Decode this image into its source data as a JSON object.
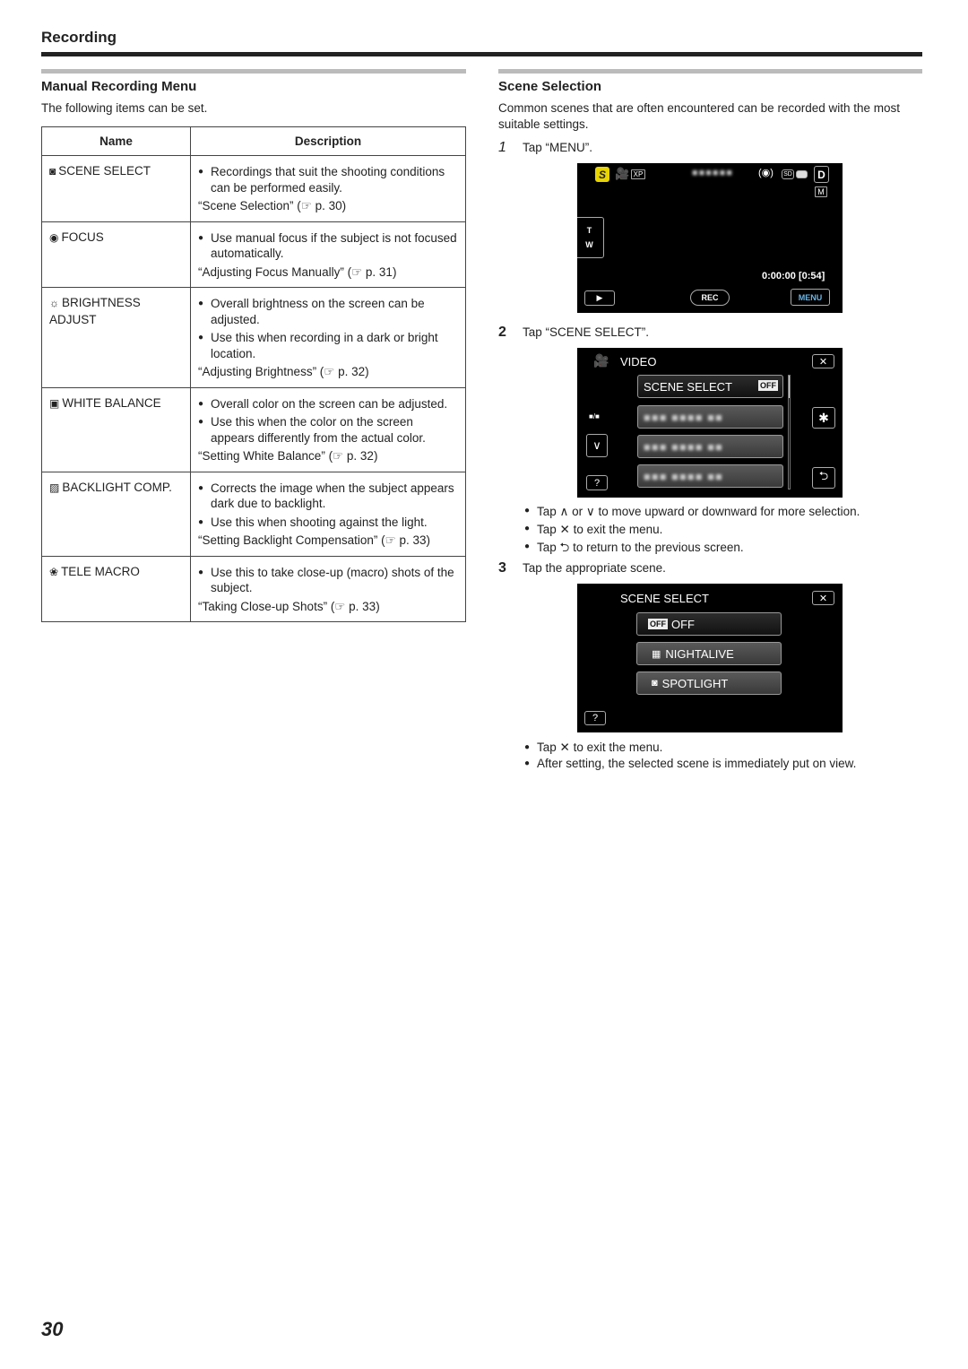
{
  "header": {
    "title": "Recording"
  },
  "left": {
    "title": "Manual Recording Menu",
    "intro": "The following items can be set.",
    "table": {
      "headers": [
        "Name",
        "Description"
      ],
      "rows": [
        {
          "icon": "scene-select-icon",
          "glyph": "◙",
          "name": "SCENE SELECT",
          "bullets": [
            "Recordings that suit the shooting conditions can be performed easily."
          ],
          "ref": "“Scene Selection” (☞ p. 30)"
        },
        {
          "icon": "focus-icon",
          "glyph": "◉",
          "name": "FOCUS",
          "bullets": [
            "Use manual focus if the subject is not focused automatically."
          ],
          "ref": "“Adjusting Focus Manually” (☞ p. 31)"
        },
        {
          "icon": "brightness-icon",
          "glyph": "☼",
          "name": "BRIGHTNESS ADJUST",
          "bullets": [
            "Overall brightness on the screen can be adjusted.",
            "Use this when recording in a dark or bright location."
          ],
          "ref": "“Adjusting Brightness” (☞ p. 32)"
        },
        {
          "icon": "white-balance-icon",
          "glyph": "▣",
          "name": "WHITE BALANCE",
          "bullets": [
            "Overall color on the screen can be adjusted.",
            "Use this when the color on the screen appears differently from the actual color."
          ],
          "ref": "“Setting White Balance” (☞ p. 32)"
        },
        {
          "icon": "backlight-icon",
          "glyph": "▨",
          "name": "BACKLIGHT COMP.",
          "bullets": [
            "Corrects the image when the subject appears dark due to backlight.",
            "Use this when shooting against the light."
          ],
          "ref": "“Setting Backlight Compensation” (☞ p. 33)"
        },
        {
          "icon": "tele-macro-icon",
          "glyph": "❀",
          "name": "TELE MACRO",
          "bullets": [
            "Use this to take close-up (macro) shots of the subject."
          ],
          "ref": "“Taking Close-up Shots” (☞ p. 33)"
        }
      ]
    }
  },
  "right": {
    "title": "Scene Selection",
    "intro": "Common scenes that are often encountered can be recorded with the most suitable settings.",
    "steps": [
      {
        "num": "1",
        "text": "Tap “MENU”."
      },
      {
        "num": "2",
        "text": "Tap “SCENE SELECT”."
      },
      {
        "num": "3",
        "text": "Tap the appropriate scene."
      }
    ],
    "screen1": {
      "s_badge": "S",
      "xp": "XP",
      "t": "T",
      "w": "W",
      "time": "0:00:00",
      "remain": "[0:54]",
      "rec": "REC",
      "menu": "MENU",
      "d": "D",
      "m": "M",
      "sd": "SD"
    },
    "screen2": {
      "title": "VIDEO",
      "item": "SCENE SELECT",
      "off": "OFF",
      "page": "■/■",
      "help": "?"
    },
    "step2_bullets": [
      "Tap ∧ or ∨ to move upward or downward for more selection.",
      "Tap ✕ to exit the menu.",
      "Tap ⮌ to return to the previous screen."
    ],
    "screen3": {
      "title": "SCENE SELECT",
      "options": [
        "OFF",
        "NIGHTALIVE",
        "SPOTLIGHT"
      ],
      "off_badge": "OFF",
      "help": "?"
    },
    "step3_bullets": [
      "Tap ✕ to exit the menu.",
      "After setting, the selected scene is immediately put on view."
    ]
  },
  "footer": {
    "page_number": "30"
  }
}
